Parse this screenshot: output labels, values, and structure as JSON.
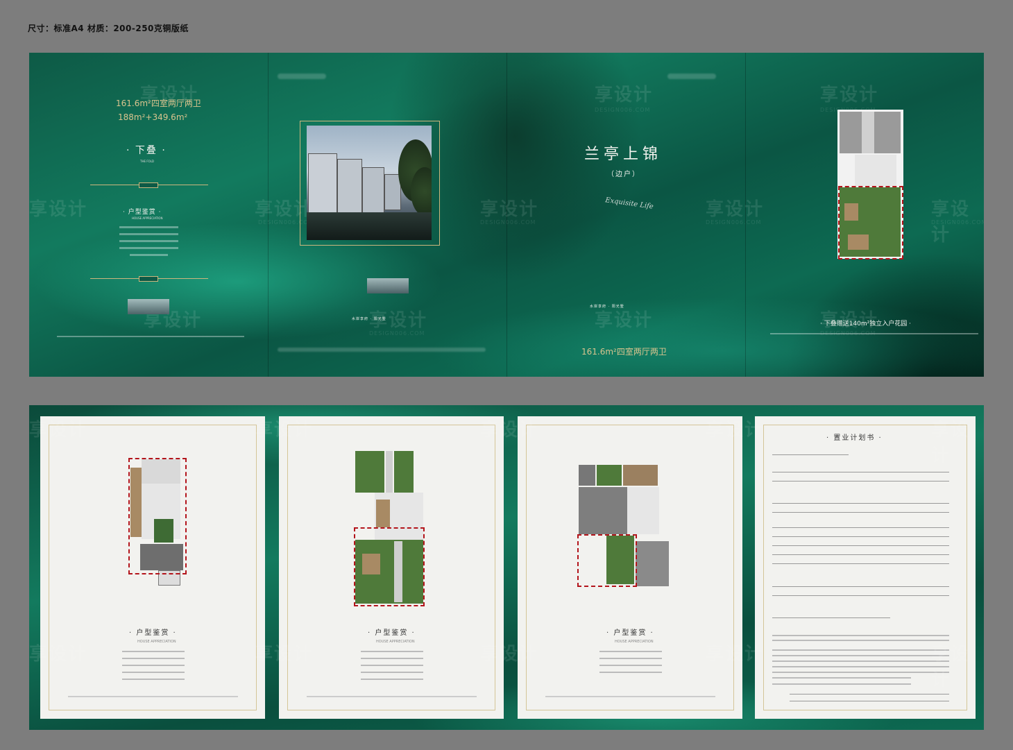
{
  "spec_text": "尺寸：标准A4 材质：200-250克铜版纸",
  "watermark": {
    "cn": "享设计",
    "en": "DESIGN006.COM"
  },
  "top_spread": {
    "panel1": {
      "area_line1": "161.6m²四室两厅两卫",
      "area_line2": "188m²+349.6m²",
      "title": "下叠",
      "title_en": "THE FOLD",
      "section_title": "户型鉴赏",
      "section_en": "HOUSE APPRECIATION"
    },
    "panel2": {
      "tagline": "水岸享府 · 阳光墅"
    },
    "panel3": {
      "title": "兰亭上锦",
      "subtitle": "（边户）",
      "script": "Exquisite Life",
      "tagline": "水岸享府 · 阳光墅",
      "area": "161.6m²四室两厅两卫"
    },
    "panel4": {
      "garden_note": "下叠赠送140m²独立入户花园"
    }
  },
  "bottom_spread": {
    "panel1": {
      "title": "户型鉴赏",
      "en": "HOUSE APPRECIATION"
    },
    "panel2": {
      "title": "户型鉴赏",
      "en": "HOUSE APPRECIATION"
    },
    "panel3": {
      "title": "户型鉴赏",
      "en": "HOUSE APPRECIATION"
    },
    "panel4": {
      "title": "置业计划书"
    }
  },
  "colors": {
    "green": "#0d6a52",
    "gold": "#cdb77e",
    "red": "#b3141b",
    "paper": "#f2f2ef"
  }
}
